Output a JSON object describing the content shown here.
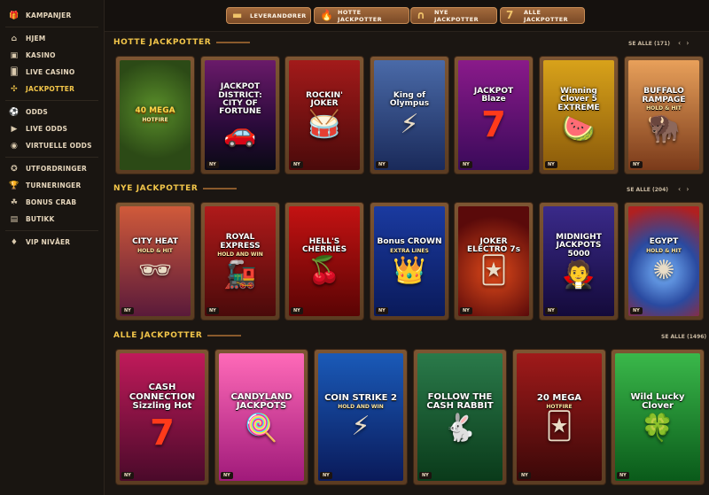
{
  "sidebar": {
    "items": [
      {
        "label": "KAMPANJER",
        "icon": "gift-icon",
        "glyph": "🎁"
      },
      {
        "label": "HJEM",
        "icon": "home-icon",
        "glyph": "⌂"
      },
      {
        "label": "KASINO",
        "icon": "slot-machine-icon",
        "glyph": "▣"
      },
      {
        "label": "LIVE CASINO",
        "icon": "cards-icon",
        "glyph": "🂠"
      },
      {
        "label": "JACKPOTTER",
        "icon": "jackpot-icon",
        "glyph": "✣",
        "active": true
      },
      {
        "label": "ODDS",
        "icon": "ball-icon",
        "glyph": "⚽"
      },
      {
        "label": "LIVE ODDS",
        "icon": "live-icon",
        "glyph": "▶"
      },
      {
        "label": "VIRTUELLE ODDS",
        "icon": "virtual-icon",
        "glyph": "◉"
      },
      {
        "label": "UTFORDRINGER",
        "icon": "badge-icon",
        "glyph": "✪"
      },
      {
        "label": "TURNERINGER",
        "icon": "trophy-icon",
        "glyph": "🏆"
      },
      {
        "label": "BONUS CRAB",
        "icon": "crab-icon",
        "glyph": "☘"
      },
      {
        "label": "BUTIKK",
        "icon": "shop-icon",
        "glyph": "▤"
      },
      {
        "label": "VIP NIVÅER",
        "icon": "diamond-icon",
        "glyph": "♦"
      }
    ]
  },
  "topnav": {
    "leverandorer": "LEVERANDØRER",
    "hotte": "HOTTE JACKPOTTER",
    "nye": "NYE JACKPOTTER",
    "alle": "ALLE JACKPOTTER"
  },
  "sections": {
    "hot": {
      "title": "HOTTE JACKPOTTER",
      "see_all": "SE ALLE (171)"
    },
    "new": {
      "title": "NYE JACKPOTTER",
      "see_all": "SE ALLE (204)"
    },
    "all": {
      "title": "ALLE JACKPOTTER",
      "see_all": "SE ALLE (1496)"
    }
  },
  "badge_new": "NY",
  "games": {
    "hot": [
      {
        "title": "40 MEGA",
        "sub": "HOTFIRE",
        "art": "",
        "new": false
      },
      {
        "title": "JACKPOT DISTRICT: CITY OF FORTUNE",
        "sub": "",
        "art": "🚗",
        "new": true
      },
      {
        "title": "ROCKIN' JOKER",
        "sub": "",
        "art": "🥁",
        "new": true
      },
      {
        "title": "King of Olympus",
        "sub": "",
        "art": "⚡",
        "new": true
      },
      {
        "title": "JACKPOT Blaze",
        "sub": "",
        "art": "7",
        "new": true
      },
      {
        "title": "Winning Clover 5 EXTREME",
        "sub": "",
        "art": "🍉",
        "new": true
      },
      {
        "title": "BUFFALO RAMPAGE",
        "sub": "HOLD & HIT",
        "art": "🦬",
        "new": true
      }
    ],
    "new": [
      {
        "title": "CITY HEAT",
        "sub": "HOLD & HIT",
        "art": "🕶",
        "new": true
      },
      {
        "title": "ROYAL EXPRESS",
        "sub": "HOLD AND WIN",
        "art": "🚂",
        "new": true
      },
      {
        "title": "HELL'S CHERRIES",
        "sub": "",
        "art": "🍒",
        "new": true
      },
      {
        "title": "Bonus CROWN",
        "sub": "EXTRA LINES",
        "art": "👑",
        "new": true
      },
      {
        "title": "JOKER ELECTRO 7s",
        "sub": "",
        "art": "🃏",
        "new": true
      },
      {
        "title": "MIDNIGHT JACKPOTS 5000",
        "sub": "",
        "art": "🧛",
        "new": true
      },
      {
        "title": "EGYPT",
        "sub": "HOLD & HIT",
        "art": "✺",
        "new": true
      }
    ],
    "all": [
      {
        "title": "CASH CONNECTION Sizzling Hot",
        "sub": "",
        "art": "7",
        "new": true
      },
      {
        "title": "CANDYLAND JACKPOTS",
        "sub": "",
        "art": "🍭",
        "new": true
      },
      {
        "title": "COIN STRIKE 2",
        "sub": "HOLD AND WIN",
        "art": "⚡",
        "new": true
      },
      {
        "title": "FOLLOW THE CASH RABBIT",
        "sub": "",
        "art": "🐇",
        "new": true
      },
      {
        "title": "20 MEGA",
        "sub": "HOTFIRE",
        "art": "🃏",
        "new": true
      },
      {
        "title": "Wild Lucky Clover",
        "sub": "",
        "art": "🍀",
        "new": true
      }
    ]
  }
}
